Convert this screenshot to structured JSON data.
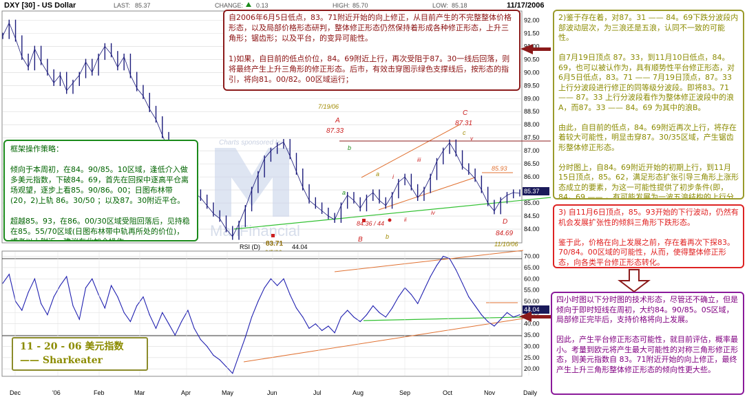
{
  "header": {
    "symbol": "DXY [30] - US Dollar",
    "last_label": "LAST:",
    "last": "85.37",
    "change_label": "CHANGE:",
    "change": "0.13",
    "high_label": "HIGH:",
    "high": "85.70",
    "low_label": "LOW:",
    "low": "85.18",
    "date": "11/17/2006"
  },
  "watermark": {
    "sponsor": "Charts sponsored by:",
    "brand": "ManFinancial"
  },
  "colors": {
    "price": "#1a1a7a",
    "rsi": "#2020b0",
    "orange": "#e07030",
    "green": "#30c030",
    "red_box": "#8b1a1a",
    "olive": "#9a9a2a",
    "purple": "#8a1a9a",
    "label_red": "#cc2020",
    "label_olive": "#a08a00"
  },
  "annotations": {
    "top": "自2006年6月5日低点，83。71附近开始的向上修正，从目前产生的不完整整体价格形态，以及局部价格形态研判，整体修正形态仍然保持着形成各种修正形态，上升三角形；锯齿形；以及平台，的变异可能性。\n\n1)如果，自目前的低点价位，84。69附近上行，再次受阻于87。30一线后回落，则将最终产生上升三角形的修正形态。后市，有效击穿图示绿色支撑线后，按形态的指引，将向81。00/82。00区域运行；",
    "left": "框架操作策略：\n\n倾向于本周初，在84。90/85。10区域，逢低介入做多美元指数，下破84。69，首先在回探中逐高平仓离场观望，逐步上看85。90/86。00；日图布林带(20，2)上轨 86。30/50 ；以及87。30附近平仓。\n\n超越85。93，在86。00/30区域受阻回落后，见持稳在85。55/70区域(日图布林带中轨再所处的价位)，或者以上附近，建议在此加仓操作。",
    "right_olive": "2)鉴于存在着，对87。31 —— 84。69下跌分波段内部波动层次，为三浪还是五浪，认同不一致的可能性。\n\n自7月19日顶点 87。33，到11月10日低点，84。69，也可以被认作为，具有顺势性平台修正形态，对6月5日低点，83。71 —— 7月19日顶点，87。33上行分波段进行修正的同等级分波段。即将83。71 —— 87。33 上行分波段看作为整体修正波段中的浪A，而87。33 —— 84。69 为其中的浪B。\n\n由此，自目前的低点，84。69附近再次上行，将存在着较大可能性，明显击穿87。30/35区域，产生锯齿形整体修正形态。\n\n分时图上，自84。69附近开始的初期上行，到11月15日顶点，85。62，满足形态扩张引导三角形上涨形态成立的要素，为这一可能性提供了初步条件(即，84。69 —— ，有可能发展为一波五浪结构的上行分波段)。",
    "right_red": "3) 自11月6日顶点，85。93开始的下行波动，仍然有机会发展扩张性的倾斜三角形下跌形态。\n\n鉴于此，价格在向上发展之前，存在着再次下探83。70/84。00区域的可能性，从而，使得整体修正形态，向各类平台修正形态转化。",
    "right_purple": "四小时图以下分时图的技术形态，尽管还不确立，但是倾向于即时短线在周初，大约84。90/85。0S区域，局部修正完毕后，支持价格将向上发展。\n\n因此，产生平台修正形态可能性，就目前评估，概率最小。考量到欧元将产生最大可能性的对称三角形修正形态，则美元指数自 83。71附近开始的向上修正，最终产生上升三角形整体修正形态的倾向性更大些。",
    "date_box": "11 - 20 - 06 美元指数\n——    Sharkeater"
  },
  "chart_data": {
    "type": "line",
    "title": "DXY [30] - US Dollar",
    "x_ticks": [
      "Dec",
      "'06",
      "Feb",
      "Mar",
      "Apr",
      "May",
      "Jun",
      "Jul",
      "Aug",
      "Sep",
      "Oct",
      "Nov",
      "Daily"
    ],
    "price_axis": {
      "ticks": [
        "92.00",
        "91.50",
        "91.00",
        "90.50",
        "90.00",
        "89.50",
        "89.00",
        "88.50",
        "88.00",
        "87.50",
        "87.00",
        "86.50",
        "86.00",
        "85.50",
        "85.00",
        "84.50",
        "84.00"
      ],
      "ylim": [
        83.5,
        92.3
      ],
      "last_value": "85.37"
    },
    "series": [
      {
        "values": [
          91.4,
          91.9,
          91.3,
          90.6,
          90.2,
          90.9,
          90.4,
          90.0,
          89.6,
          89.9,
          89.3,
          89.6,
          89.9,
          90.4,
          90.0,
          90.6,
          91.0,
          90.7,
          90.2,
          90.6,
          89.9,
          89.4,
          89.1,
          88.6,
          88.2,
          87.6,
          87.0,
          86.6,
          86.2,
          85.8,
          85.4,
          85.2,
          84.9,
          84.6,
          84.4,
          84.0,
          83.71,
          84.2,
          84.8,
          85.5,
          86.1,
          86.7,
          87.0,
          87.2,
          87.33,
          86.8,
          86.2,
          85.6,
          85.1,
          84.9,
          84.7,
          84.5,
          84.36,
          84.9,
          85.3,
          85.1,
          84.8,
          85.2,
          85.4,
          85.1,
          84.9,
          85.3,
          85.8,
          86.0,
          85.6,
          85.2,
          85.5,
          86.0,
          86.6,
          87.0,
          87.31,
          86.9,
          86.4,
          86.2,
          85.93,
          85.5,
          85.0,
          84.69,
          85.1,
          85.3,
          85.4,
          85.37
        ]
      },
      {
        "name": "RSI (D)",
        "values": [
          58,
          62,
          50,
          46,
          54,
          60,
          49,
          44,
          52,
          57,
          61,
          48,
          42,
          56,
          60,
          53,
          47,
          57,
          52,
          45,
          41,
          48,
          52,
          44,
          38,
          45,
          40,
          35,
          41,
          46,
          38,
          33,
          30,
          26,
          24,
          21,
          18,
          26,
          34,
          43,
          50,
          56,
          60,
          57,
          60,
          53,
          47,
          43,
          38,
          40,
          37,
          39,
          36,
          43,
          46,
          43,
          41,
          44,
          48,
          45,
          43,
          47,
          52,
          56,
          53,
          49,
          55,
          61,
          66,
          70,
          69,
          64,
          58,
          52,
          48,
          44,
          41,
          39,
          42,
          45,
          43,
          44.04
        ]
      }
    ],
    "rsi_axis": {
      "ticks": [
        "70.00",
        "65.00",
        "60.00",
        "55.00",
        "50.00",
        "45.00",
        "40.00",
        "35.00",
        "30.00",
        "25.00",
        "20.00"
      ],
      "ylim": [
        17,
        72
      ],
      "last_value": "44.04",
      "label": "RSI (D)"
    },
    "labels": {
      "date_top": "7/19/06",
      "A": "A",
      "A_val": "87.33",
      "C": "C",
      "C_val": "87.31",
      "val_8593": "85.93",
      "B_val": "84.36 / 44",
      "B": "B",
      "D": "D",
      "D_val": "84.69",
      "date_d": "11/10/06",
      "low_val": "83.71",
      "date_low": "6/5/06",
      "w_a": "a",
      "w_b": "b",
      "w_c": "c",
      "w_i": "i",
      "w_ii": "ii",
      "w_iii": "iii",
      "w_iv": "iv",
      "w_v": "v",
      "w_a2": "a",
      "w_b2": "b"
    }
  }
}
